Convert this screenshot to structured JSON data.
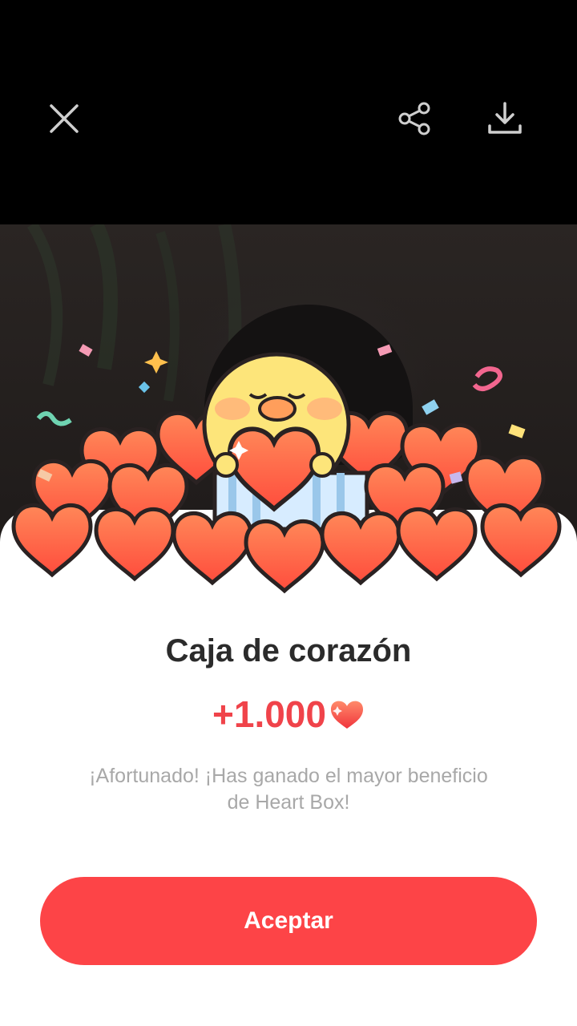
{
  "toolbar": {
    "close_icon": "close-icon",
    "share_icon": "share-icon",
    "download_icon": "download-icon"
  },
  "dialog": {
    "title": "Caja de corazón",
    "reward_amount": "+1.000",
    "reward_icon": "heart-icon",
    "message": "¡Afortunado! ¡Has ganado el mayor beneficio de Heart Box!",
    "accept_label": "Aceptar"
  },
  "colors": {
    "accent": "#fd4447",
    "reward_text": "#f0434a",
    "title_text": "#2b2b2b",
    "message_text": "#a8a8a8",
    "heart_fill": "#ff6a4d",
    "chick_fill": "#fde57a"
  }
}
